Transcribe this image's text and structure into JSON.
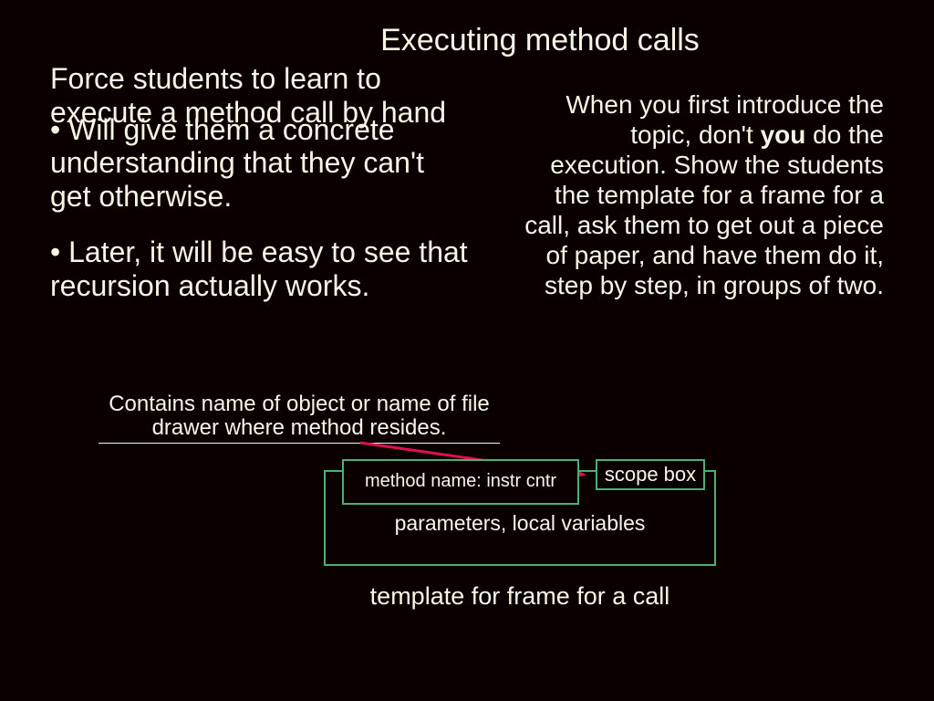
{
  "title": "Executing method calls",
  "left": {
    "force": "Force students to learn to execute a method call by hand",
    "bullet1_mark": "•",
    "bullet1": " Will give them a concrete understanding that they can't get otherwise.",
    "bullet2_mark": "•",
    "bullet2": " Later, it will be easy to see that recursion actually works."
  },
  "right": {
    "line1": "When you first introduce the topic, don't ",
    "bold": "you",
    "line2": " do the execution. Show the students the template for a frame for a call, ask them to get out a piece of paper, and have them do it, step by step, in groups of two."
  },
  "diagram": {
    "scope_note": "Contains name of object or name of file drawer where method resides.",
    "method_box": "method name: instr cntr",
    "scope_box": "scope box",
    "params": "parameters, local variables",
    "caption": "template for frame for a call"
  }
}
